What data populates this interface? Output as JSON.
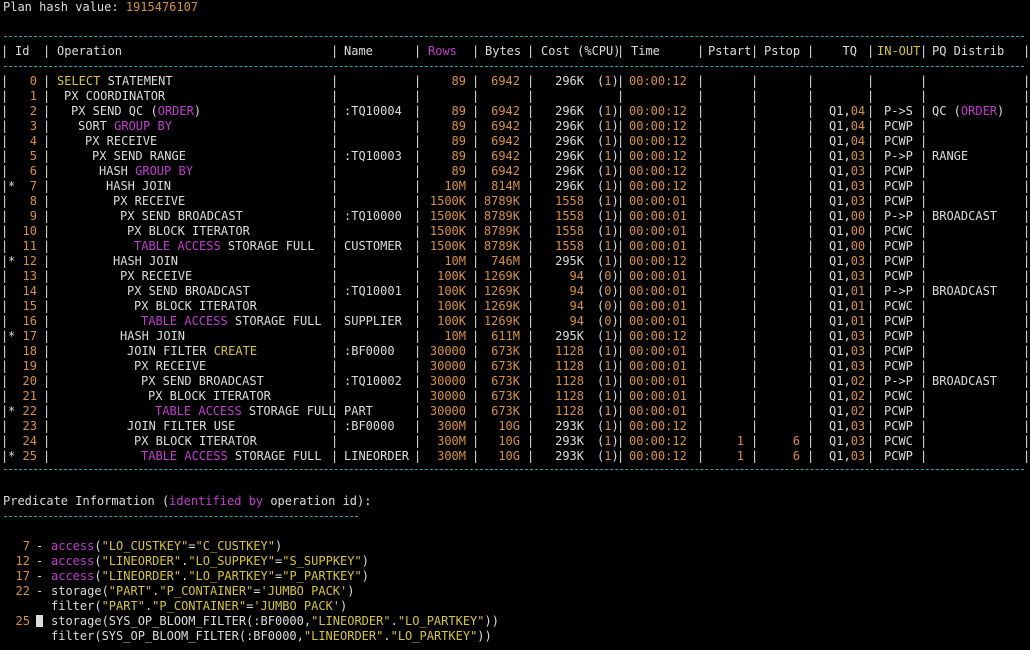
{
  "hash": {
    "label": "Plan hash value: ",
    "value": "1915476107"
  },
  "headers": [
    "Id",
    "Operation",
    "Name",
    "Rows",
    "Bytes",
    "Cost (%CPU)",
    "Time",
    "Pstart",
    "Pstop",
    "TQ",
    "IN-OUT",
    "PQ Distrib"
  ],
  "rows": [
    {
      "star": "",
      "id": "0",
      "op": [
        [
          "y",
          "SELECT"
        ],
        [
          "w",
          " STATEMENT"
        ]
      ],
      "name": "",
      "rows": "89",
      "bytes": "6942",
      "cost": "296K",
      "cpu": "1",
      "time": "00:00:12",
      "pstart": "",
      "pstop": "",
      "tq": "",
      "inout": "",
      "pq": []
    },
    {
      "star": "",
      "id": "1",
      "op": [
        [
          "w",
          "PX COORDINATOR"
        ]
      ],
      "name": "",
      "rows": "",
      "bytes": "",
      "cost": "",
      "cpu": "",
      "time": "",
      "pstart": "",
      "pstop": "",
      "tq": "",
      "inout": "",
      "pq": []
    },
    {
      "star": "",
      "id": "2",
      "op": [
        [
          "w",
          "PX SEND QC ("
        ],
        [
          "m",
          "ORDER"
        ],
        [
          "w",
          ")"
        ]
      ],
      "name": ":TQ10004",
      "rows": "89",
      "bytes": "6942",
      "cost": "296K",
      "cpu": "1",
      "time": "00:00:12",
      "pstart": "",
      "pstop": "",
      "tq": [
        "Q1,",
        "04"
      ],
      "inout": "P->S",
      "pq": [
        [
          "w",
          "QC ("
        ],
        [
          "m",
          "ORDER"
        ],
        [
          "w",
          ")"
        ]
      ]
    },
    {
      "star": "",
      "id": "3",
      "op": [
        [
          "w",
          "SORT "
        ],
        [
          "m",
          "GROUP BY"
        ]
      ],
      "name": "",
      "rows": "89",
      "bytes": "6942",
      "cost": "296K",
      "cpu": "1",
      "time": "00:00:12",
      "pstart": "",
      "pstop": "",
      "tq": [
        "Q1,",
        "04"
      ],
      "inout": "PCWP",
      "pq": []
    },
    {
      "star": "",
      "id": "4",
      "op": [
        [
          "w",
          "PX RECEIVE"
        ]
      ],
      "name": "",
      "rows": "89",
      "bytes": "6942",
      "cost": "296K",
      "cpu": "1",
      "time": "00:00:12",
      "pstart": "",
      "pstop": "",
      "tq": [
        "Q1,",
        "04"
      ],
      "inout": "PCWP",
      "pq": []
    },
    {
      "star": "",
      "id": "5",
      "op": [
        [
          "w",
          "PX SEND RANGE"
        ]
      ],
      "name": ":TQ10003",
      "rows": "89",
      "bytes": "6942",
      "cost": "296K",
      "cpu": "1",
      "time": "00:00:12",
      "pstart": "",
      "pstop": "",
      "tq": [
        "Q1,",
        "03"
      ],
      "inout": "P->P",
      "pq": [
        [
          "w",
          "RANGE"
        ]
      ]
    },
    {
      "star": "",
      "id": "6",
      "op": [
        [
          "w",
          "HASH "
        ],
        [
          "m",
          "GROUP BY"
        ]
      ],
      "name": "",
      "rows": "89",
      "bytes": "6942",
      "cost": "296K",
      "cpu": "1",
      "time": "00:00:12",
      "pstart": "",
      "pstop": "",
      "tq": [
        "Q1,",
        "03"
      ],
      "inout": "PCWP",
      "pq": []
    },
    {
      "star": "*",
      "id": "7",
      "op": [
        [
          "w",
          "HASH JOIN"
        ]
      ],
      "name": "",
      "rows": "10M",
      "bytes": "814M",
      "cost": "296K",
      "cpu": "1",
      "time": "00:00:12",
      "pstart": "",
      "pstop": "",
      "tq": [
        "Q1,",
        "03"
      ],
      "inout": "PCWP",
      "pq": []
    },
    {
      "star": "",
      "id": "8",
      "op": [
        [
          "w",
          "PX RECEIVE"
        ]
      ],
      "name": "",
      "rows": "1500K",
      "bytes": "8789K",
      "cost": "1558",
      "cpu": "1",
      "time": "00:00:01",
      "pstart": "",
      "pstop": "",
      "tq": [
        "Q1,",
        "03"
      ],
      "inout": "PCWP",
      "pq": []
    },
    {
      "star": "",
      "id": "9",
      "op": [
        [
          "w",
          "PX SEND BROADCAST"
        ]
      ],
      "name": ":TQ10000",
      "rows": "1500K",
      "bytes": "8789K",
      "cost": "1558",
      "cpu": "1",
      "time": "00:00:01",
      "pstart": "",
      "pstop": "",
      "tq": [
        "Q1,",
        "00"
      ],
      "inout": "P->P",
      "pq": [
        [
          "w",
          "BROADCAST"
        ]
      ]
    },
    {
      "star": "",
      "id": "10",
      "op": [
        [
          "w",
          "PX BLOCK ITERATOR"
        ]
      ],
      "name": "",
      "rows": "1500K",
      "bytes": "8789K",
      "cost": "1558",
      "cpu": "1",
      "time": "00:00:01",
      "pstart": "",
      "pstop": "",
      "tq": [
        "Q1,",
        "00"
      ],
      "inout": "PCWC",
      "pq": []
    },
    {
      "star": "",
      "id": "11",
      "op": [
        [
          "m",
          "TABLE ACCESS"
        ],
        [
          "w",
          " STORAGE FULL"
        ]
      ],
      "name": "CUSTOMER",
      "rows": "1500K",
      "bytes": "8789K",
      "cost": "1558",
      "cpu": "1",
      "time": "00:00:01",
      "pstart": "",
      "pstop": "",
      "tq": [
        "Q1,",
        "00"
      ],
      "inout": "PCWP",
      "pq": []
    },
    {
      "star": "*",
      "id": "12",
      "op": [
        [
          "w",
          "HASH JOIN"
        ]
      ],
      "name": "",
      "rows": "10M",
      "bytes": "746M",
      "cost": "295K",
      "cpu": "1",
      "time": "00:00:12",
      "pstart": "",
      "pstop": "",
      "tq": [
        "Q1,",
        "03"
      ],
      "inout": "PCWP",
      "pq": []
    },
    {
      "star": "",
      "id": "13",
      "op": [
        [
          "w",
          "PX RECEIVE"
        ]
      ],
      "name": "",
      "rows": "100K",
      "bytes": "1269K",
      "cost": "94",
      "cpu": "0",
      "time": "00:00:01",
      "pstart": "",
      "pstop": "",
      "tq": [
        "Q1,",
        "03"
      ],
      "inout": "PCWP",
      "pq": []
    },
    {
      "star": "",
      "id": "14",
      "op": [
        [
          "w",
          "PX SEND BROADCAST"
        ]
      ],
      "name": ":TQ10001",
      "rows": "100K",
      "bytes": "1269K",
      "cost": "94",
      "cpu": "0",
      "time": "00:00:01",
      "pstart": "",
      "pstop": "",
      "tq": [
        "Q1,",
        "01"
      ],
      "inout": "P->P",
      "pq": [
        [
          "w",
          "BROADCAST"
        ]
      ]
    },
    {
      "star": "",
      "id": "15",
      "op": [
        [
          "w",
          "PX BLOCK ITERATOR"
        ]
      ],
      "name": "",
      "rows": "100K",
      "bytes": "1269K",
      "cost": "94",
      "cpu": "0",
      "time": "00:00:01",
      "pstart": "",
      "pstop": "",
      "tq": [
        "Q1,",
        "01"
      ],
      "inout": "PCWC",
      "pq": []
    },
    {
      "star": "",
      "id": "16",
      "op": [
        [
          "m",
          "TABLE ACCESS"
        ],
        [
          "w",
          " STORAGE FULL"
        ]
      ],
      "name": "SUPPLIER",
      "rows": "100K",
      "bytes": "1269K",
      "cost": "94",
      "cpu": "0",
      "time": "00:00:01",
      "pstart": "",
      "pstop": "",
      "tq": [
        "Q1,",
        "01"
      ],
      "inout": "PCWP",
      "pq": []
    },
    {
      "star": "*",
      "id": "17",
      "op": [
        [
          "w",
          "HASH JOIN"
        ]
      ],
      "name": "",
      "rows": "10M",
      "bytes": "611M",
      "cost": "295K",
      "cpu": "1",
      "time": "00:00:12",
      "pstart": "",
      "pstop": "",
      "tq": [
        "Q1,",
        "03"
      ],
      "inout": "PCWP",
      "pq": []
    },
    {
      "star": "",
      "id": "18",
      "op": [
        [
          "w",
          "JOIN FILTER "
        ],
        [
          "y",
          "CREATE"
        ]
      ],
      "name": ":BF0000",
      "rows": "30000",
      "bytes": "673K",
      "cost": "1128",
      "cpu": "1",
      "time": "00:00:01",
      "pstart": "",
      "pstop": "",
      "tq": [
        "Q1,",
        "03"
      ],
      "inout": "PCWP",
      "pq": []
    },
    {
      "star": "",
      "id": "19",
      "op": [
        [
          "w",
          "PX RECEIVE"
        ]
      ],
      "name": "",
      "rows": "30000",
      "bytes": "673K",
      "cost": "1128",
      "cpu": "1",
      "time": "00:00:01",
      "pstart": "",
      "pstop": "",
      "tq": [
        "Q1,",
        "03"
      ],
      "inout": "PCWP",
      "pq": []
    },
    {
      "star": "",
      "id": "20",
      "op": [
        [
          "w",
          "PX SEND BROADCAST"
        ]
      ],
      "name": ":TQ10002",
      "rows": "30000",
      "bytes": "673K",
      "cost": "1128",
      "cpu": "1",
      "time": "00:00:01",
      "pstart": "",
      "pstop": "",
      "tq": [
        "Q1,",
        "02"
      ],
      "inout": "P->P",
      "pq": [
        [
          "w",
          "BROADCAST"
        ]
      ]
    },
    {
      "star": "",
      "id": "21",
      "op": [
        [
          "w",
          "PX BLOCK ITERATOR"
        ]
      ],
      "name": "",
      "rows": "30000",
      "bytes": "673K",
      "cost": "1128",
      "cpu": "1",
      "time": "00:00:01",
      "pstart": "",
      "pstop": "",
      "tq": [
        "Q1,",
        "02"
      ],
      "inout": "PCWC",
      "pq": []
    },
    {
      "star": "*",
      "id": "22",
      "op": [
        [
          "m",
          "TABLE ACCESS"
        ],
        [
          "w",
          " STORAGE FULL"
        ]
      ],
      "name": "PART",
      "rows": "30000",
      "bytes": "673K",
      "cost": "1128",
      "cpu": "1",
      "time": "00:00:01",
      "pstart": "",
      "pstop": "",
      "tq": [
        "Q1,",
        "02"
      ],
      "inout": "PCWP",
      "pq": []
    },
    {
      "star": "",
      "id": "23",
      "op": [
        [
          "w",
          "JOIN FILTER USE"
        ]
      ],
      "name": ":BF0000",
      "rows": "300M",
      "bytes": "10G",
      "cost": "293K",
      "cpu": "1",
      "time": "00:00:12",
      "pstart": "",
      "pstop": "",
      "tq": [
        "Q1,",
        "03"
      ],
      "inout": "PCWP",
      "pq": []
    },
    {
      "star": "",
      "id": "24",
      "op": [
        [
          "w",
          "PX BLOCK ITERATOR"
        ]
      ],
      "name": "",
      "rows": "300M",
      "bytes": "10G",
      "cost": "293K",
      "cpu": "1",
      "time": "00:00:12",
      "pstart": "1",
      "pstop": "6",
      "tq": [
        "Q1,",
        "03"
      ],
      "inout": "PCWC",
      "pq": []
    },
    {
      "star": "*",
      "id": "25",
      "op": [
        [
          "m",
          "TABLE ACCESS"
        ],
        [
          "w",
          " STORAGE FULL"
        ]
      ],
      "name": "LINEORDER",
      "rows": "300M",
      "bytes": "10G",
      "cost": "293K",
      "cpu": "1",
      "time": "00:00:12",
      "pstart": "1",
      "pstop": "6",
      "tq": [
        "Q1,",
        "03"
      ],
      "inout": "PCWP",
      "pq": []
    }
  ],
  "predicate_title": [
    [
      "w",
      "Predicate Information ("
    ],
    [
      "m",
      "identified by"
    ],
    [
      "w",
      " operation id):"
    ]
  ],
  "predicates": [
    {
      "num": "7",
      "text": [
        [
          "m",
          "access"
        ],
        [
          "w",
          "("
        ],
        [
          "y",
          "\"LO_CUSTKEY\""
        ],
        [
          "w",
          "="
        ],
        [
          "y",
          "\"C_CUSTKEY\""
        ],
        [
          "w",
          ")"
        ]
      ]
    },
    {
      "num": "12",
      "text": [
        [
          "m",
          "access"
        ],
        [
          "w",
          "("
        ],
        [
          "y",
          "\"LINEORDER\""
        ],
        [
          "w",
          "."
        ],
        [
          "y",
          "\"LO_SUPPKEY\""
        ],
        [
          "w",
          "="
        ],
        [
          "y",
          "\"S_SUPPKEY\""
        ],
        [
          "w",
          ")"
        ]
      ]
    },
    {
      "num": "17",
      "text": [
        [
          "m",
          "access"
        ],
        [
          "w",
          "("
        ],
        [
          "y",
          "\"LINEORDER\""
        ],
        [
          "w",
          "."
        ],
        [
          "y",
          "\"LO_PARTKEY\""
        ],
        [
          "w",
          "="
        ],
        [
          "y",
          "\"P_PARTKEY\""
        ],
        [
          "w",
          ")"
        ]
      ]
    },
    {
      "num": "22",
      "text": [
        [
          "w",
          "storage("
        ],
        [
          "y",
          "\"PART\""
        ],
        [
          "w",
          "."
        ],
        [
          "y",
          "\"P_CONTAINER\""
        ],
        [
          "w",
          "="
        ],
        [
          "y",
          "'JUMBO PACK'"
        ],
        [
          "w",
          ")"
        ]
      ]
    },
    {
      "num": "",
      "text": [
        [
          "w",
          "filter("
        ],
        [
          "y",
          "\"PART\""
        ],
        [
          "w",
          "."
        ],
        [
          "y",
          "\"P_CONTAINER\""
        ],
        [
          "w",
          "="
        ],
        [
          "y",
          "'JUMBO PACK'"
        ],
        [
          "w",
          ")"
        ]
      ]
    },
    {
      "num": "25",
      "cursor": true,
      "text": [
        [
          "w",
          "storage(SYS_OP_BLOOM_FILTER(:BF0000,"
        ],
        [
          "y",
          "\"LINEORDER\""
        ],
        [
          "w",
          "."
        ],
        [
          "y",
          "\"LO_PARTKEY\""
        ],
        [
          "w",
          "))"
        ]
      ]
    },
    {
      "num": "",
      "text": [
        [
          "w",
          "filter(SYS_OP_BLOOM_FILTER(:BF0000,"
        ],
        [
          "y",
          "\"LINEORDER\""
        ],
        [
          "w",
          "."
        ],
        [
          "y",
          "\"LO_PARTKEY\""
        ],
        [
          "w",
          "))"
        ]
      ]
    }
  ],
  "colors": {
    "white": "#dcdcdc",
    "orange": "#d8913f",
    "yellow": "#d6c43a",
    "magenta": "#c23bcf",
    "cyan": "#2aa8a8",
    "background": "#000000"
  }
}
